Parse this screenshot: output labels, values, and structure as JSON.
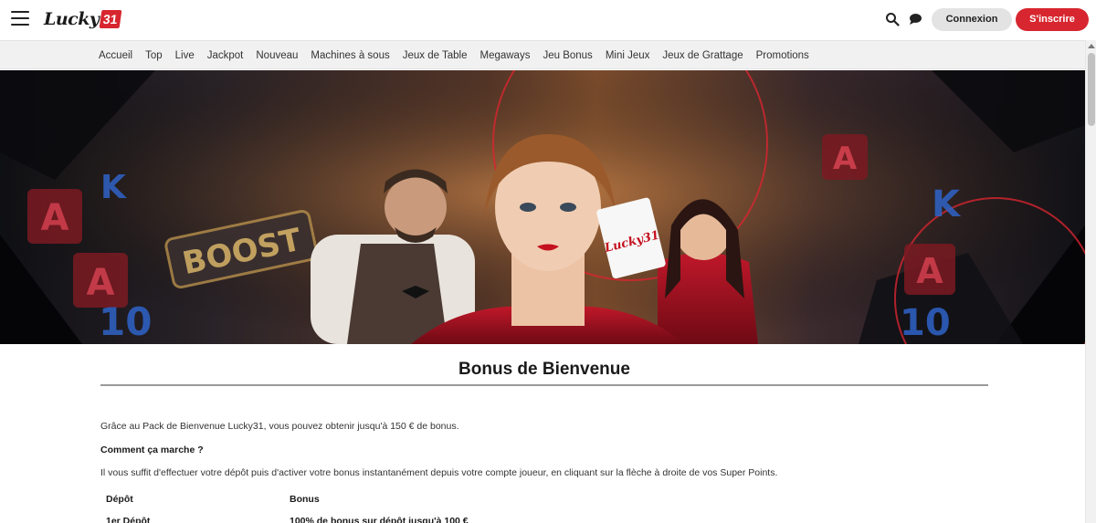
{
  "header": {
    "logo_text": "Lucky",
    "logo_badge": "31",
    "login_label": "Connexion",
    "signup_label": "S'inscrire",
    "accent_color": "#d7262f"
  },
  "nav": {
    "items": [
      {
        "label": "Accueil"
      },
      {
        "label": "Top"
      },
      {
        "label": "Live"
      },
      {
        "label": "Jackpot"
      },
      {
        "label": "Nouveau"
      },
      {
        "label": "Machines à sous"
      },
      {
        "label": "Jeux de Table"
      },
      {
        "label": "Megaways"
      },
      {
        "label": "Jeu Bonus"
      },
      {
        "label": "Mini Jeux"
      },
      {
        "label": "Jeux de Grattage"
      },
      {
        "label": "Promotions"
      }
    ]
  },
  "banner": {
    "card_text": "Lucky31",
    "slot_text": "BOOST"
  },
  "content": {
    "title": "Bonus de Bienvenue",
    "intro": "Grâce au Pack de Bienvenue Lucky31, vous pouvez obtenir jusqu'à 150 € de bonus.",
    "how_heading": "Comment ça marche ?",
    "how_text": "Il vous suffit d'effectuer votre dépôt puis d'activer votre bonus instantanément depuis votre compte joueur, en cliquant sur la flèche à droite de vos Super Points.",
    "table": {
      "headers": [
        "Dépôt",
        "Bonus"
      ],
      "rows": [
        [
          "1er Dépôt",
          "100% de bonus sur dépôt jusqu'à 100 €"
        ]
      ]
    }
  },
  "icons": {
    "menu": "hamburger-icon",
    "search": "search-icon",
    "chat": "chat-icon"
  }
}
